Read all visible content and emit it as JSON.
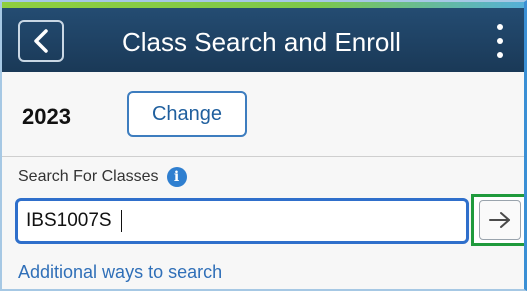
{
  "header": {
    "title": "Class Search and Enroll",
    "back_icon": "chevron-left-icon",
    "menu_icon": "kebab-menu-icon",
    "background_color": "#1c3f60",
    "accent_color": "#8fcf3f"
  },
  "term": {
    "year": "2023",
    "change_label": "Change"
  },
  "search": {
    "label": "Search For Classes",
    "info_icon": "info-icon",
    "info_glyph": "i",
    "value": "IBS1007S",
    "go_icon": "arrow-right-icon",
    "additional_link": "Additional ways to search"
  },
  "colors": {
    "link": "#2f6fb8",
    "input_border": "#2f6fcb",
    "go_highlight": "#1f9a3c"
  }
}
